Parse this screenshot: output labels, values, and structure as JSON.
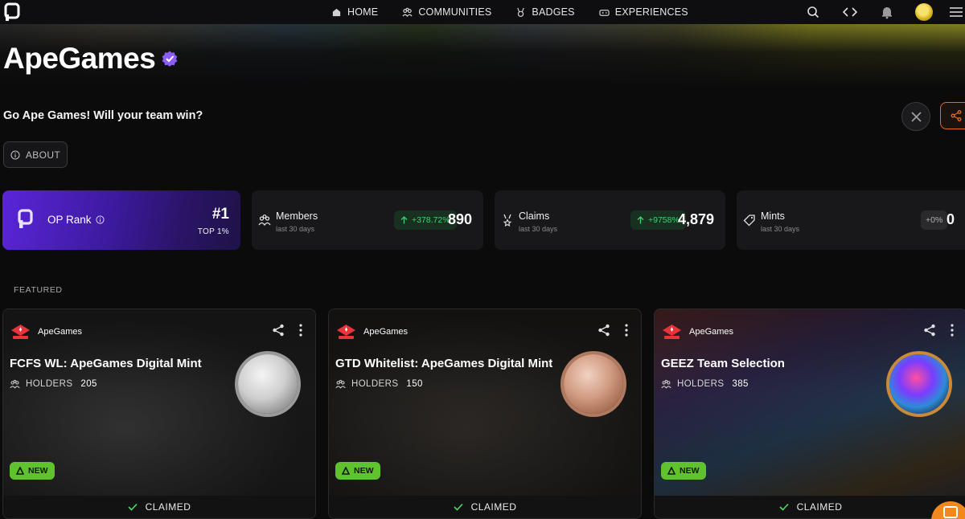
{
  "nav": {
    "links": [
      {
        "label": "HOME",
        "icon": "home-icon"
      },
      {
        "label": "COMMUNITIES",
        "icon": "communities-icon"
      },
      {
        "label": "BADGES",
        "icon": "badge-icon"
      },
      {
        "label": "EXPERIENCES",
        "icon": "gamepad-icon"
      }
    ],
    "icons": [
      "search-icon",
      "code-icon",
      "bell-icon",
      "avatar",
      "menu-icon"
    ]
  },
  "community": {
    "name": "ApeGames",
    "description": "Go Ape Games! Will your team win?",
    "about_label": "ABOUT"
  },
  "stats": {
    "rank": {
      "label": "OP Rank",
      "value": "#1",
      "sub": "TOP 1%"
    },
    "members": {
      "label": "Members",
      "sub": "last 30 days",
      "change": "+378.72%",
      "value": "890"
    },
    "claims": {
      "label": "Claims",
      "sub": "last 30 days",
      "change": "+9758%",
      "value": "4,879"
    },
    "mints": {
      "label": "Mints",
      "sub": "last 30 days",
      "change": "+0%",
      "value": "0"
    }
  },
  "featured_label": "FEATURED",
  "cards": [
    {
      "org": "ApeGames",
      "title": "FCFS WL: ApeGames Digital Mint",
      "holders_label": "HOLDERS",
      "holders": "205",
      "new_label": "NEW",
      "claimed_label": "CLAIMED"
    },
    {
      "org": "ApeGames",
      "title": "GTD Whitelist: ApeGames Digital Mint",
      "holders_label": "HOLDERS",
      "holders": "150",
      "new_label": "NEW",
      "claimed_label": "CLAIMED"
    },
    {
      "org": "ApeGames",
      "title": "GEEZ Team Selection",
      "holders_label": "HOLDERS",
      "holders": "385",
      "new_label": "NEW",
      "claimed_label": "CLAIMED"
    }
  ],
  "colors": {
    "accent_orange": "#e86a1a",
    "rank_purple": "#5a25d8",
    "positive_green": "#3fd36e",
    "new_green": "#5fc22e",
    "verified_purple": "#8b5cf6"
  }
}
